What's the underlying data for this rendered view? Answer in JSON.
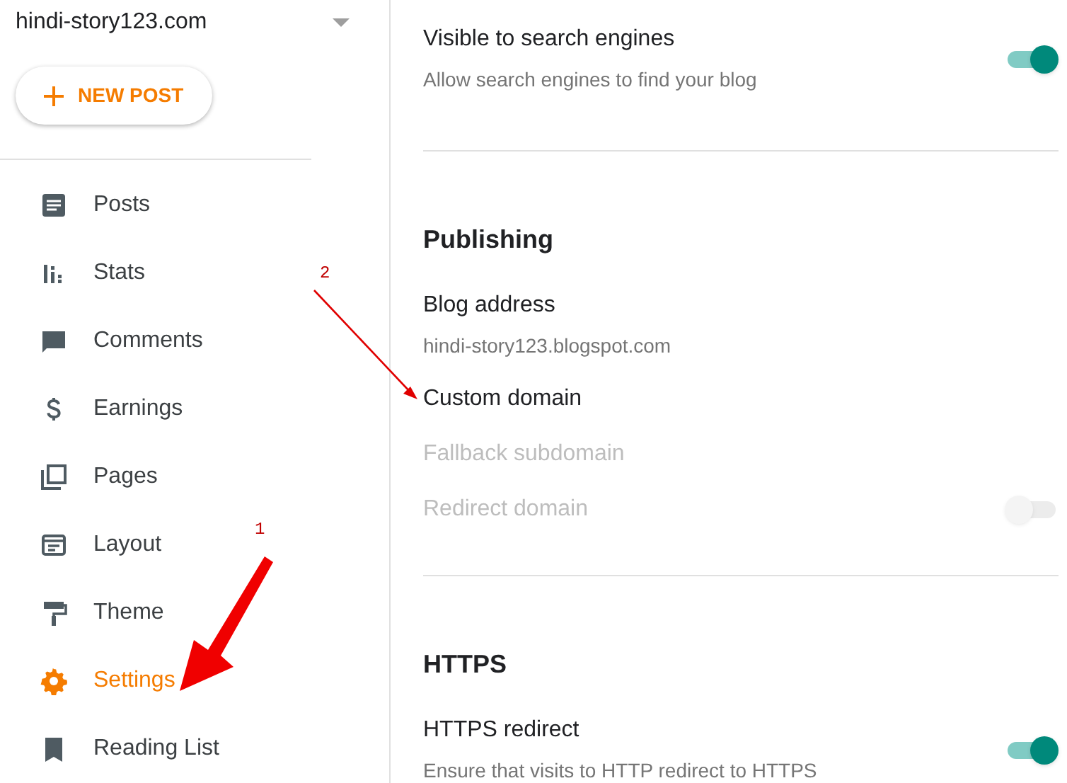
{
  "sidebar": {
    "blog_name": "hindi-story123.com",
    "new_post_button": "NEW POST",
    "items": [
      {
        "label": "Posts",
        "selected": false
      },
      {
        "label": "Stats",
        "selected": false
      },
      {
        "label": "Comments",
        "selected": false
      },
      {
        "label": "Earnings",
        "selected": false
      },
      {
        "label": "Pages",
        "selected": false
      },
      {
        "label": "Layout",
        "selected": false
      },
      {
        "label": "Theme",
        "selected": false
      },
      {
        "label": "Settings",
        "selected": true
      },
      {
        "label": "Reading List",
        "selected": false
      }
    ]
  },
  "settings": [
    {
      "items": [
        {
          "label": "Visible to search engines",
          "description": "Allow search engines to find your blog",
          "disabled": false,
          "toggle_on": true
        }
      ]
    },
    {
      "title": "Publishing",
      "items": [
        {
          "label": "Blog address",
          "description": "hindi-story123.blogspot.com",
          "disabled": false
        },
        {
          "label": "Custom domain",
          "disabled": false
        },
        {
          "label": "Fallback subdomain",
          "disabled": true
        },
        {
          "label": "Redirect domain",
          "disabled": true,
          "toggle_on": false
        }
      ]
    },
    {
      "title": "HTTPS",
      "items": [
        {
          "label": "HTTPS redirect",
          "description": "Ensure that visits to HTTP redirect to HTTPS",
          "disabled": false,
          "toggle_on": true
        }
      ]
    }
  ],
  "annotations": [
    {
      "label": "1"
    },
    {
      "label": "2"
    }
  ]
}
